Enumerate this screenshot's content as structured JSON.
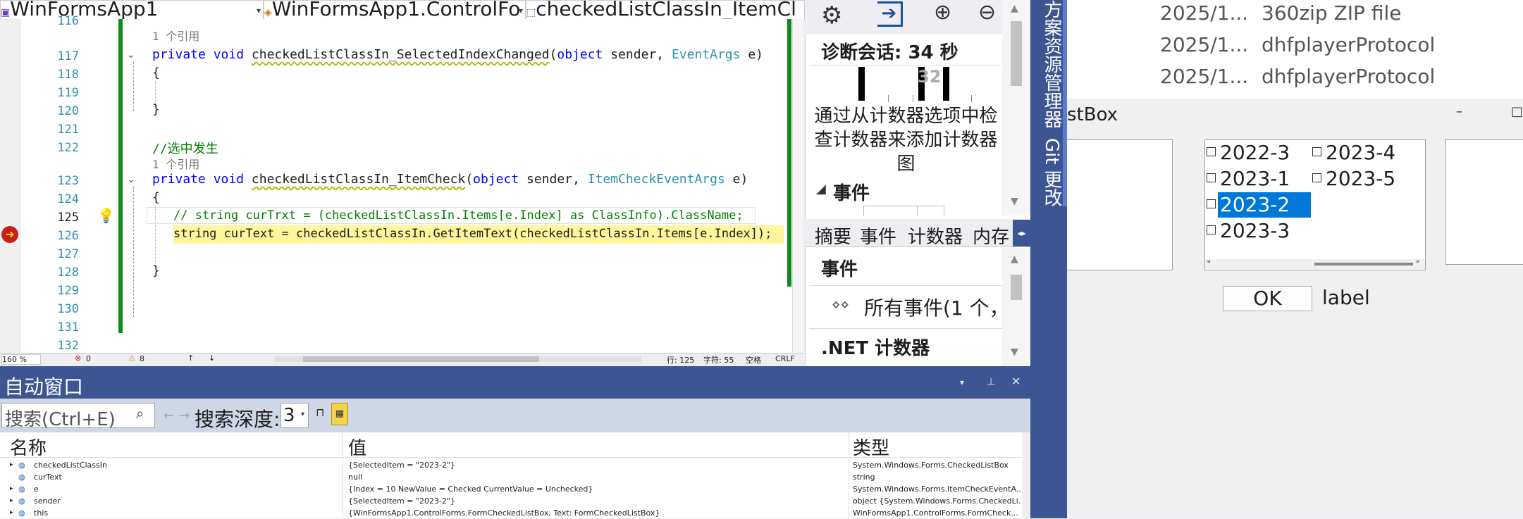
{
  "editor": {
    "dropdowns": [
      "WinFormsApp1",
      "WinFormsApp1.ControlFo",
      "checkedListClassIn_ItemCl"
    ],
    "lines": [
      {
        "num": "116",
        "text": ""
      },
      {
        "num": "117",
        "text": ""
      },
      {
        "num": "118",
        "text": "{"
      },
      {
        "num": "119",
        "text": ""
      },
      {
        "num": "120",
        "text": "}"
      },
      {
        "num": "121",
        "text": ""
      },
      {
        "num": "122",
        "text": "//选中发生"
      },
      {
        "num": "123",
        "text": ""
      },
      {
        "num": "124",
        "text": "{"
      },
      {
        "num": "125",
        "text": "// string curTrxt = (checkedListClassIn.Items[e.Index] as ClassInfo).ClassName;"
      },
      {
        "num": "126",
        "text": "string curText = checkedListClassIn.GetItemText(checkedListClassIn.Items[e.Index]);"
      },
      {
        "num": "127",
        "text": ""
      },
      {
        "num": "128",
        "text": "}"
      },
      {
        "num": "129",
        "text": ""
      },
      {
        "num": "130",
        "text": ""
      },
      {
        "num": "131",
        "text": ""
      },
      {
        "num": "132",
        "text": ""
      }
    ],
    "ref1": "1 个引用",
    "ref2": "1 个引用",
    "sig1": {
      "kw": "private void",
      "name": "checkedListClassIn_SelectedIndexChanged",
      "p1": "object",
      "p1n": "sender,",
      "p2": "EventArgs",
      "p2n": "e)"
    },
    "sig2": {
      "kw": "private void",
      "name": "checkedListClassIn_ItemCheck",
      "p1": "object",
      "p1n": "sender,",
      "p2": "ItemCheckEventArgs",
      "p2n": "e)"
    },
    "status": {
      "zoom": "160 %",
      "errors": "0",
      "warnings": "8",
      "line": "行: 125",
      "col": "字符: 55",
      "ws": "空格",
      "eol": "CRLF"
    }
  },
  "diagnostics": {
    "session": "诊断会话: 34 秒",
    "timeline_label": "32",
    "counter_hint": "通过从计数器选项中检查计数器来添加计数器图",
    "events_header": "事件",
    "tabs": [
      "摘要",
      "事件",
      "计数器",
      "内存"
    ],
    "events_title": "事件",
    "all_events": "所有事件(1 个，",
    "net_counters": ".NET 计数器"
  },
  "side_tabs": {
    "explorer": "方案资源管理器",
    "git": "Git 更改"
  },
  "autos": {
    "title": "自动窗口",
    "search_placeholder": "搜索(Ctrl+E)",
    "depth_label": "搜索深度:",
    "depth_value": "3",
    "columns": [
      "名称",
      "值",
      "类型"
    ],
    "rows": [
      {
        "name": "checkedListClassIn",
        "value": "{SelectedItem = \"2023-2\"}",
        "type": "System.Windows.Forms.CheckedListBox"
      },
      {
        "name": "curText",
        "value": "null",
        "type": "string"
      },
      {
        "name": "e",
        "value": "{Index = 10 NewValue = Checked CurrentValue = Unchecked}",
        "type": "System.Windows.Forms.ItemCheckEventA..."
      },
      {
        "name": "sender",
        "value": "{SelectedItem = \"2023-2\"}",
        "type": "object {System.Windows.Forms.CheckedLi..."
      },
      {
        "name": "this",
        "value": "{WinFormsApp1.ControlForms.FormCheckedListBox, Text: FormCheckedListBox}",
        "type": "WinFormsApp1.ControlForms.FormCheck..."
      }
    ]
  },
  "explorer_files": [
    {
      "date": "2025/1...",
      "type": "360zip ZIP file"
    },
    {
      "date": "2025/1...",
      "type": "dhfplayerProtocol"
    },
    {
      "date": "2025/1...",
      "type": "dhfplayerProtocol"
    }
  ],
  "form": {
    "title": "stBox",
    "items_col1": [
      "2022-3",
      "2023-1",
      "2023-2",
      "2023-3"
    ],
    "items_col2": [
      "2023-4",
      "2023-5"
    ],
    "selected": "2023-2",
    "ok_label": "OK",
    "label_text": "label",
    "min_glyph": "–",
    "max_glyph": "□"
  },
  "colors": {
    "accent": "#0078d7",
    "vs_blue": "#3e5593",
    "highlight": "#fff59b",
    "git_bar": "#3b5ba5"
  }
}
